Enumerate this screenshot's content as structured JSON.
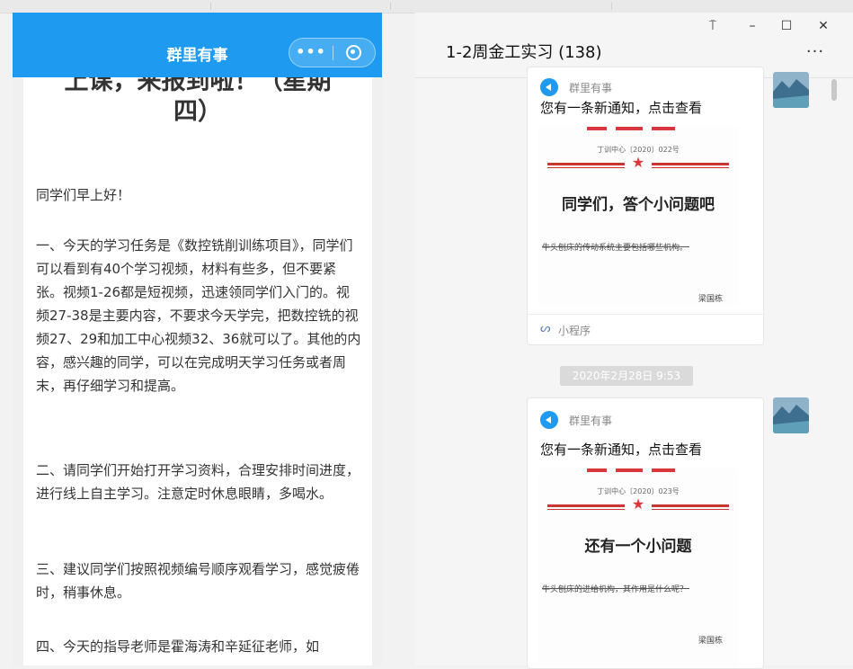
{
  "mini_program": {
    "title": "群里有事",
    "more_glyph": "•••",
    "article": {
      "title": "上课，来报到啦！（星期四）",
      "paragraphs": [
        "同学们早上好！",
        "一、今天的学习任务是《数控铣削训练项目》，同学们可以看到有40个学习视频，材料有些多，但不要紧张。视频1-26都是短视频，迅速领同学们入门的。视频27-38是主要内容，不要求今天学完，把数控铣的视频27、29和加工中心视频32、36就可以了。其他的内容，感兴趣的同学，可以在完成明天学习任务或者周末，再仔细学习和提高。",
        "二、请同学们开始打开学习资料，合理安排时间进度，进行线上自主学习。注意定时休息眼睛，多喝水。",
        "三、建议同学们按照视频编号顺序观看学习，感觉疲倦时，稍事休息。",
        "四、今天的指导老师是霍海涛和辛延征老师，如"
      ]
    }
  },
  "chat": {
    "title": "1-2周金工实习 (138)",
    "window_buttons": [
      "pin-icon",
      "minimize-icon",
      "maximize-icon",
      "close-icon"
    ],
    "more_glyph": "···",
    "messages": [
      {
        "source_name": "群里有事",
        "description": "您有一条新通知，点击查看",
        "poster": {
          "doc_number": "丁训中心〔2020〕022号",
          "title": "同学们，答个小问题吧",
          "body_line": "牛头刨床的传动系统主要包括哪些机构。",
          "signature": "梁国栋"
        },
        "footer_label": "小程序"
      },
      {
        "source_name": "群里有事",
        "description": "您有一条新通知，点击查看",
        "poster": {
          "doc_number": "丁训中心〔2020〕023号",
          "title": "还有一个小问题",
          "body_line": "牛头刨床的进给机构，其作用是什么呢？",
          "signature": "梁国栋"
        }
      }
    ],
    "timestamp": "2020年2月28日 9:53"
  },
  "colors": {
    "accent": "#1e9bf0",
    "poster_red": "#d9373c"
  }
}
